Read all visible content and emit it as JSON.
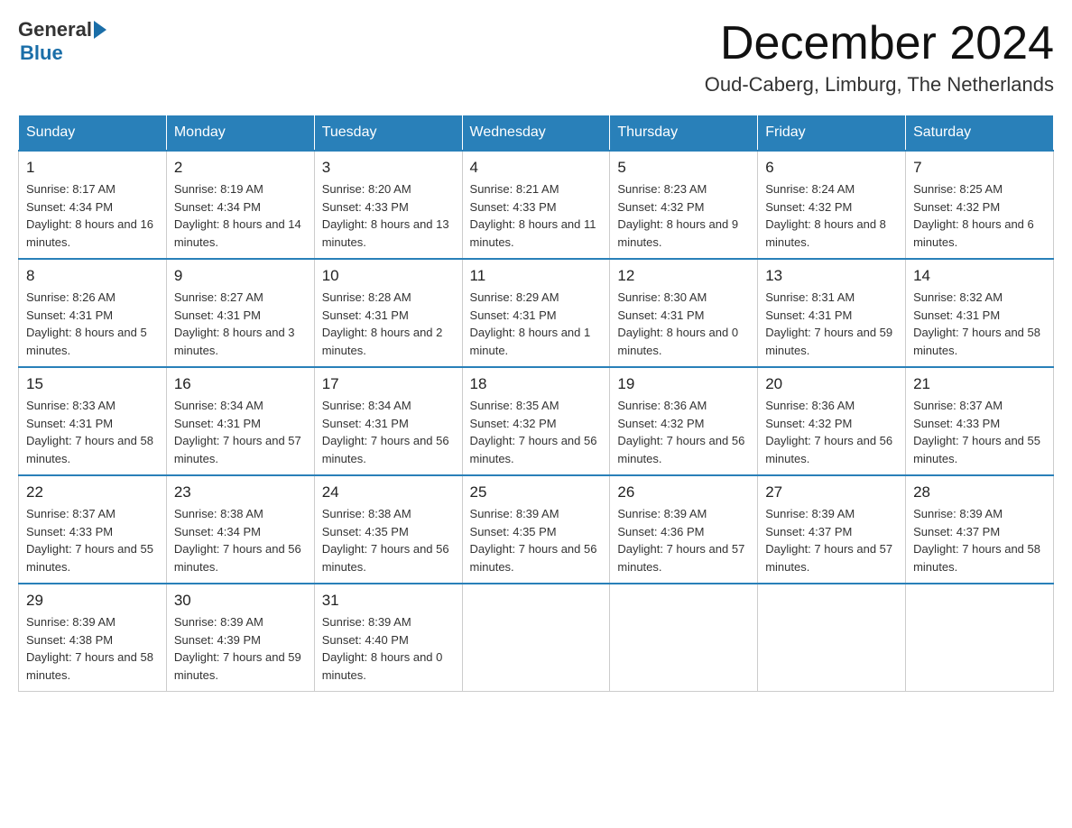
{
  "header": {
    "logo_general": "General",
    "logo_blue": "Blue",
    "month_title": "December 2024",
    "location": "Oud-Caberg, Limburg, The Netherlands"
  },
  "weekdays": [
    "Sunday",
    "Monday",
    "Tuesday",
    "Wednesday",
    "Thursday",
    "Friday",
    "Saturday"
  ],
  "weeks": [
    [
      {
        "day": "1",
        "sunrise": "8:17 AM",
        "sunset": "4:34 PM",
        "daylight": "8 hours and 16 minutes."
      },
      {
        "day": "2",
        "sunrise": "8:19 AM",
        "sunset": "4:34 PM",
        "daylight": "8 hours and 14 minutes."
      },
      {
        "day": "3",
        "sunrise": "8:20 AM",
        "sunset": "4:33 PM",
        "daylight": "8 hours and 13 minutes."
      },
      {
        "day": "4",
        "sunrise": "8:21 AM",
        "sunset": "4:33 PM",
        "daylight": "8 hours and 11 minutes."
      },
      {
        "day": "5",
        "sunrise": "8:23 AM",
        "sunset": "4:32 PM",
        "daylight": "8 hours and 9 minutes."
      },
      {
        "day": "6",
        "sunrise": "8:24 AM",
        "sunset": "4:32 PM",
        "daylight": "8 hours and 8 minutes."
      },
      {
        "day": "7",
        "sunrise": "8:25 AM",
        "sunset": "4:32 PM",
        "daylight": "8 hours and 6 minutes."
      }
    ],
    [
      {
        "day": "8",
        "sunrise": "8:26 AM",
        "sunset": "4:31 PM",
        "daylight": "8 hours and 5 minutes."
      },
      {
        "day": "9",
        "sunrise": "8:27 AM",
        "sunset": "4:31 PM",
        "daylight": "8 hours and 3 minutes."
      },
      {
        "day": "10",
        "sunrise": "8:28 AM",
        "sunset": "4:31 PM",
        "daylight": "8 hours and 2 minutes."
      },
      {
        "day": "11",
        "sunrise": "8:29 AM",
        "sunset": "4:31 PM",
        "daylight": "8 hours and 1 minute."
      },
      {
        "day": "12",
        "sunrise": "8:30 AM",
        "sunset": "4:31 PM",
        "daylight": "8 hours and 0 minutes."
      },
      {
        "day": "13",
        "sunrise": "8:31 AM",
        "sunset": "4:31 PM",
        "daylight": "7 hours and 59 minutes."
      },
      {
        "day": "14",
        "sunrise": "8:32 AM",
        "sunset": "4:31 PM",
        "daylight": "7 hours and 58 minutes."
      }
    ],
    [
      {
        "day": "15",
        "sunrise": "8:33 AM",
        "sunset": "4:31 PM",
        "daylight": "7 hours and 58 minutes."
      },
      {
        "day": "16",
        "sunrise": "8:34 AM",
        "sunset": "4:31 PM",
        "daylight": "7 hours and 57 minutes."
      },
      {
        "day": "17",
        "sunrise": "8:34 AM",
        "sunset": "4:31 PM",
        "daylight": "7 hours and 56 minutes."
      },
      {
        "day": "18",
        "sunrise": "8:35 AM",
        "sunset": "4:32 PM",
        "daylight": "7 hours and 56 minutes."
      },
      {
        "day": "19",
        "sunrise": "8:36 AM",
        "sunset": "4:32 PM",
        "daylight": "7 hours and 56 minutes."
      },
      {
        "day": "20",
        "sunrise": "8:36 AM",
        "sunset": "4:32 PM",
        "daylight": "7 hours and 56 minutes."
      },
      {
        "day": "21",
        "sunrise": "8:37 AM",
        "sunset": "4:33 PM",
        "daylight": "7 hours and 55 minutes."
      }
    ],
    [
      {
        "day": "22",
        "sunrise": "8:37 AM",
        "sunset": "4:33 PM",
        "daylight": "7 hours and 55 minutes."
      },
      {
        "day": "23",
        "sunrise": "8:38 AM",
        "sunset": "4:34 PM",
        "daylight": "7 hours and 56 minutes."
      },
      {
        "day": "24",
        "sunrise": "8:38 AM",
        "sunset": "4:35 PM",
        "daylight": "7 hours and 56 minutes."
      },
      {
        "day": "25",
        "sunrise": "8:39 AM",
        "sunset": "4:35 PM",
        "daylight": "7 hours and 56 minutes."
      },
      {
        "day": "26",
        "sunrise": "8:39 AM",
        "sunset": "4:36 PM",
        "daylight": "7 hours and 57 minutes."
      },
      {
        "day": "27",
        "sunrise": "8:39 AM",
        "sunset": "4:37 PM",
        "daylight": "7 hours and 57 minutes."
      },
      {
        "day": "28",
        "sunrise": "8:39 AM",
        "sunset": "4:37 PM",
        "daylight": "7 hours and 58 minutes."
      }
    ],
    [
      {
        "day": "29",
        "sunrise": "8:39 AM",
        "sunset": "4:38 PM",
        "daylight": "7 hours and 58 minutes."
      },
      {
        "day": "30",
        "sunrise": "8:39 AM",
        "sunset": "4:39 PM",
        "daylight": "7 hours and 59 minutes."
      },
      {
        "day": "31",
        "sunrise": "8:39 AM",
        "sunset": "4:40 PM",
        "daylight": "8 hours and 0 minutes."
      },
      null,
      null,
      null,
      null
    ]
  ]
}
